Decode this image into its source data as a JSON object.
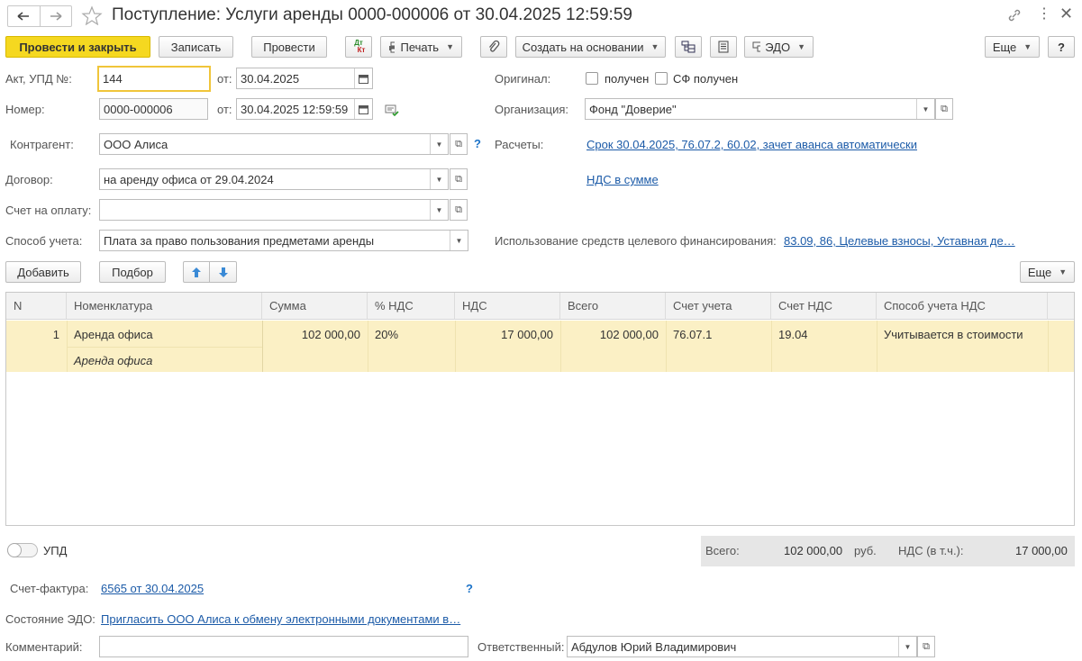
{
  "title": "Поступление: Услуги аренды 0000-000006 от 30.04.2025 12:59:59",
  "toolbar": {
    "post_close": "Провести и закрыть",
    "save": "Записать",
    "post": "Провести",
    "print": "Печать",
    "create_based": "Создать на основании",
    "edo": "ЭДО",
    "more": "Еще",
    "help": "?",
    "dtkt_top": "Дт",
    "dtkt_bottom": "Кт"
  },
  "form": {
    "act_label": "Акт, УПД №:",
    "act_value": "144",
    "from_label": "от:",
    "act_date": "30.04.2025",
    "number_label": "Номер:",
    "number_value": "0000-000006",
    "number_date": "30.04.2025 12:59:59",
    "contractor_label": "Контрагент:",
    "contractor_value": "ООО Алиса",
    "contract_label": "Договор:",
    "contract_value": "на аренду офиса от 29.04.2024",
    "invoice_label": "Счет на оплату:",
    "invoice_value": "",
    "method_label": "Способ учета:",
    "method_value": "Плата за право пользования предметами аренды",
    "original_label": "Оригинал:",
    "received_label": "получен",
    "sf_received_label": "СФ получен",
    "org_label": "Организация:",
    "org_value": "Фонд \"Доверие\"",
    "settlements_label": "Расчеты:",
    "settlements_link": "Срок 30.04.2025, 76.07.2, 60.02, зачет аванса автоматически",
    "vat_link": "НДС в сумме",
    "funding_label": "Использование средств целевого финансирования:",
    "funding_link": "83.09, 86, Целевые взносы, Уставная де…",
    "help": "?"
  },
  "table_toolbar": {
    "add": "Добавить",
    "select": "Подбор",
    "more": "Еще"
  },
  "table": {
    "headers": [
      "N",
      "Номенклатура",
      "Сумма",
      "% НДС",
      "НДС",
      "Всего",
      "Счет учета",
      "Счет НДС",
      "Способ учета НДС"
    ],
    "rows": [
      {
        "n": "1",
        "item": "Аренда офиса",
        "item_sub": "Аренда офиса",
        "sum": "102 000,00",
        "vat_rate": "20%",
        "vat": "17 000,00",
        "total": "102 000,00",
        "account": "76.07.1",
        "vat_account": "19.04",
        "vat_method": "Учитывается в стоимости"
      }
    ]
  },
  "footer": {
    "upd_label": "УПД",
    "total_label": "Всего:",
    "total_value": "102 000,00",
    "currency": "руб.",
    "vat_label": "НДС (в т.ч.):",
    "vat_value": "17 000,00",
    "sf_label": "Счет-фактура:",
    "sf_link": "6565 от 30.04.2025",
    "help": "?",
    "edo_label": "Состояние ЭДО:",
    "edo_link": "Пригласить ООО Алиса к обмену электронными документами в…",
    "comment_label": "Комментарий:",
    "comment_value": "",
    "responsible_label": "Ответственный:",
    "responsible_value": "Абдулов Юрий Владимирович"
  },
  "colors": {
    "primary_button": "#f5d820",
    "selected_row": "#fbf0c5",
    "link": "#1c5ba8",
    "focus_border": "#f0c53a"
  }
}
